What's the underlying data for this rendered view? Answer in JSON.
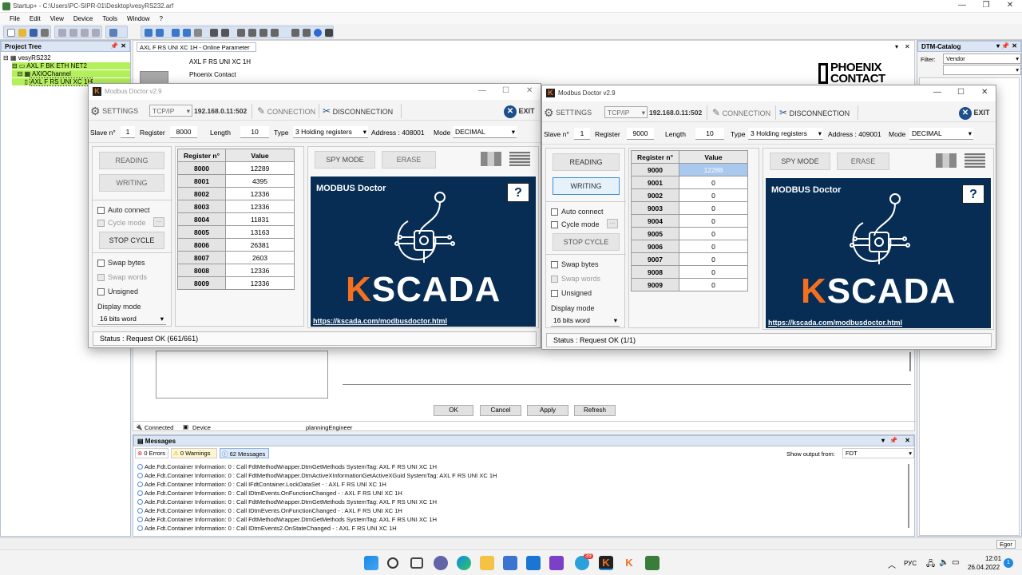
{
  "window": {
    "title": "Startup+ - C:\\Users\\PC-SIPR-01\\Desktop\\vesyRS232.arf"
  },
  "menu": [
    "File",
    "Edit",
    "View",
    "Device",
    "Tools",
    "Window",
    "?"
  ],
  "project_tree": {
    "title": "Project Tree",
    "items": [
      "vesyRS232",
      "AXL F BK ETH NET2",
      "AXIOChannel",
      "AXL F RS UNI XC 1H"
    ]
  },
  "doc_tab": {
    "title": "AXL F RS UNI XC 1H - Online Parameter"
  },
  "device": {
    "name": "AXL F RS UNI XC 1H",
    "vendor": "Phoenix Contact"
  },
  "phoenix_logo": {
    "line1": "PHOENIX",
    "line2": "CONTACT"
  },
  "dtm_catalog": {
    "title": "DTM-Catalog",
    "filter_label": "Filter:",
    "filter_value": "Vendor"
  },
  "dialog_buttons": {
    "ok": "OK",
    "cancel": "Cancel",
    "apply": "Apply",
    "refresh": "Refresh"
  },
  "status_strip": {
    "connected": "Connected",
    "device": "Device",
    "user": "planningEngineer"
  },
  "messages": {
    "title": "Messages",
    "errors": "0 Errors",
    "warnings": "0 Warnings",
    "count": "62 Messages",
    "show_output_label": "Show output from:",
    "show_output_value": "FDT",
    "lines": [
      "Ade.Fdt.Container Information: 0 : Call FdtMethodWrapper.DtmGetMethods  SystemTag: AXL F RS UNI XC 1H",
      "Ade.Fdt.Container Information: 0 : Call FdtMethodWrapper.DtmActiveXInformationGetActiveXGuid  SystemTag: AXL F RS UNI XC 1H",
      "Ade.Fdt.Container Information: 0 : Call IFdtContainer.LockDataSet  - : AXL F RS UNI XC 1H",
      "Ade.Fdt.Container Information: 0 : Call IDtmEvents.OnFunctionChanged  - : AXL F RS UNI XC 1H",
      "Ade.Fdt.Container Information: 0 : Call FdtMethodWrapper.DtmGetMethods  SystemTag: AXL F RS UNI XC 1H",
      "Ade.Fdt.Container Information: 0 : Call IDtmEvents.OnFunctionChanged  - : AXL F RS UNI XC 1H",
      "Ade.Fdt.Container Information: 0 : Call FdtMethodWrapper.DtmGetMethods  SystemTag: AXL F RS UNI XC 1H",
      "Ade.Fdt.Container Information: 0 : Call IDtmEvents2.OnStateChanged  - : AXL F RS UNI XC 1H"
    ]
  },
  "app_status": {
    "user": "Egor"
  },
  "modbus_left": {
    "title": "Modbus Doctor v2.9",
    "settings": "SETTINGS",
    "protocol": "TCP/IP",
    "address": "192.168.0.11:502",
    "connection": "CONNECTION",
    "disconnection": "DISCONNECTION",
    "exit": "EXIT",
    "slave_label": "Slave n°",
    "slave": "1",
    "register_label": "Register",
    "register": "8000",
    "length_label": "Length",
    "length": "10",
    "type_label": "Type",
    "type": "3 Holding registers",
    "address_label": "Address : 408001",
    "mode_label": "Mode",
    "mode": "DECIMAL",
    "reading": "READING",
    "writing": "WRITING",
    "auto_connect": "Auto connect",
    "cycle_mode": "Cycle mode",
    "stop_cycle": "STOP CYCLE",
    "swap_bytes": "Swap bytes",
    "swap_words": "Swap words",
    "unsigned": "Unsigned",
    "display_mode_label": "Display mode",
    "display_mode": "16 bits word",
    "col_register": "Register n°",
    "col_value": "Value",
    "rows": [
      {
        "reg": "8000",
        "val": "12289"
      },
      {
        "reg": "8001",
        "val": "4395"
      },
      {
        "reg": "8002",
        "val": "12336"
      },
      {
        "reg": "8003",
        "val": "12336"
      },
      {
        "reg": "8004",
        "val": "11831"
      },
      {
        "reg": "8005",
        "val": "13163"
      },
      {
        "reg": "8006",
        "val": "26381"
      },
      {
        "reg": "8007",
        "val": "2603"
      },
      {
        "reg": "8008",
        "val": "12336"
      },
      {
        "reg": "8009",
        "val": "12336"
      }
    ],
    "spy_mode": "SPY MODE",
    "erase": "ERASE",
    "panel_title": "MODBUS Doctor",
    "help": "?",
    "brand": "SCADA",
    "brand_k": "K",
    "url": "https://kscada.com/modbusdoctor.html",
    "status": "Status : Request OK (661/661)"
  },
  "modbus_right": {
    "title": "Modbus Doctor v2.9",
    "settings": "SETTINGS",
    "protocol": "TCP/IP",
    "address": "192.168.0.11:502",
    "connection": "CONNECTION",
    "disconnection": "DISCONNECTION",
    "exit": "EXIT",
    "slave_label": "Slave n°",
    "slave": "1",
    "register_label": "Register",
    "register": "9000",
    "length_label": "Length",
    "length": "10",
    "type_label": "Type",
    "type": "3 Holding registers",
    "address_label": "Address : 409001",
    "mode_label": "Mode",
    "mode": "DECIMAL",
    "reading": "READING",
    "writing": "WRITING",
    "auto_connect": "Auto connect",
    "cycle_mode": "Cycle mode",
    "stop_cycle": "STOP CYCLE",
    "swap_bytes": "Swap bytes",
    "swap_words": "Swap words",
    "unsigned": "Unsigned",
    "display_mode_label": "Display mode",
    "display_mode": "16 bits word",
    "col_register": "Register n°",
    "col_value": "Value",
    "rows": [
      {
        "reg": "9000",
        "val": "12288"
      },
      {
        "reg": "9001",
        "val": "0"
      },
      {
        "reg": "9002",
        "val": "0"
      },
      {
        "reg": "9003",
        "val": "0"
      },
      {
        "reg": "9004",
        "val": "0"
      },
      {
        "reg": "9005",
        "val": "0"
      },
      {
        "reg": "9006",
        "val": "0"
      },
      {
        "reg": "9007",
        "val": "0"
      },
      {
        "reg": "9008",
        "val": "0"
      },
      {
        "reg": "9009",
        "val": "0"
      }
    ],
    "spy_mode": "SPY MODE",
    "erase": "ERASE",
    "panel_title": "MODBUS Doctor",
    "help": "?",
    "brand": "SCADA",
    "brand_k": "K",
    "url": "https://kscada.com/modbusdoctor.html",
    "status": "Status : Request OK (1/1)"
  },
  "taskbar": {
    "lang": "РУС",
    "time": "12:01",
    "date": "26.04.2022",
    "notif": "1",
    "badge": "39"
  },
  "colors": {
    "accent_blue": "#0a2d55",
    "kscada_orange": "#f37021",
    "tree_highlight": "#b4f05a"
  }
}
